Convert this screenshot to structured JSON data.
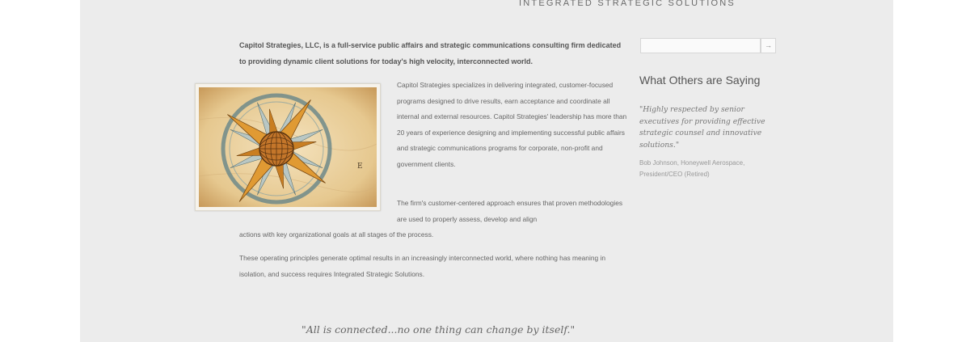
{
  "header": {
    "tagline": "Integrated Strategic Solutions"
  },
  "main": {
    "lead": "Capitol Strategies, LLC, is a full-service public affairs and strategic communications consulting firm dedicated to providing dynamic client solutions for today's high velocity, interconnected world.",
    "image_icon": "compass-rose-icon",
    "paragraph1": "Capitol Strategies specializes in delivering integrated, customer-focused programs designed to drive results, earn acceptance and coordinate all internal and external resources. Capitol Strategies' leadership has more than 20 years of experience designing and implementing successful public affairs and strategic communications programs for corporate, non-profit and government clients.",
    "paragraph2_start": "The firm's customer-centered approach ensures that proven methodologies are used to properly assess, develop and align",
    "paragraph2_end": "actions with key organizational goals at all stages of the process.",
    "paragraph3": "These operating principles generate optimal results in an increasingly interconnected world, where nothing has meaning in isolation, and success requires Integrated Strategic Solutions.",
    "closing_quote": "\"All is connected...no one thing can change by itself.\""
  },
  "sidebar": {
    "search_value": "",
    "search_button": "→",
    "title": "What Others are Saying",
    "testimonial": "\"Highly respected by senior executives for providing effective strategic counsel and innovative solutions.\"",
    "attribution": "Bob Johnson, Honeywell Aerospace, President/CEO (Retired)"
  },
  "colors": {
    "page_bg": "#ececec",
    "body_text": "#666666",
    "compass_orange": "#d9902e",
    "compass_teal": "#5a7d80"
  }
}
